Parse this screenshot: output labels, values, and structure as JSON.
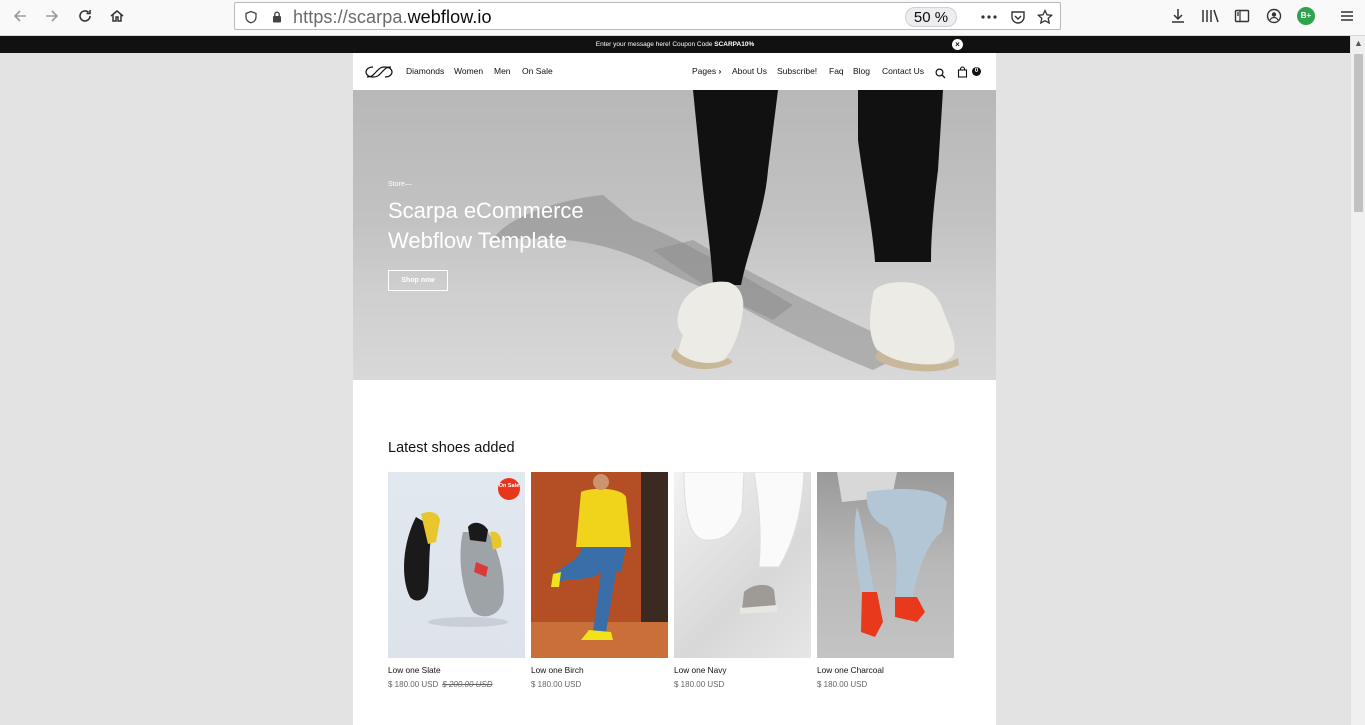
{
  "browser": {
    "url_prefix": "https://scarpa.",
    "url_host": "webflow.io",
    "zoom": "50 %",
    "icons": [
      "back-icon",
      "forward-icon",
      "reload-icon",
      "home-icon",
      "shield-icon",
      "lock-icon",
      "more-icon",
      "pocket-icon",
      "star-icon",
      "download-icon",
      "library-icon",
      "sidebar-icon",
      "account-icon",
      "extension-icon",
      "menu-icon"
    ],
    "extension_label": "B+"
  },
  "announcement": {
    "text": "Enter your message here! Coupon Code ",
    "code": "SCARPA10%",
    "close": "×"
  },
  "nav": {
    "left": [
      "Diamonds",
      "Women",
      "Men",
      "On Sale"
    ],
    "right": [
      "Pages",
      "About Us",
      "Subscribe!",
      "Faq",
      "Blog",
      "Contact Us"
    ],
    "pages_chevron": "›",
    "cart_count": "0"
  },
  "hero": {
    "eyebrow": "Store—",
    "title": "Scarpa eCommerce Webflow Template",
    "button": "Shop now"
  },
  "latest": {
    "title": "Latest shoes added",
    "products": [
      {
        "name": "Low one Slate",
        "price": "$ 180.00 USD",
        "old_price": "$ 200.00 USD",
        "badge": "On Sale"
      },
      {
        "name": "Low one Birch",
        "price": "$ 180.00 USD",
        "old_price": "",
        "badge": ""
      },
      {
        "name": "Low one Navy",
        "price": "$ 180.00 USD",
        "old_price": "",
        "badge": ""
      },
      {
        "name": "Low one Charcoal",
        "price": "$ 180.00 USD",
        "old_price": "",
        "badge": ""
      }
    ]
  },
  "colors": {
    "sale_badge": "#e8361c",
    "announcement_bg": "#111111",
    "extension_green": "#2ea44f"
  }
}
